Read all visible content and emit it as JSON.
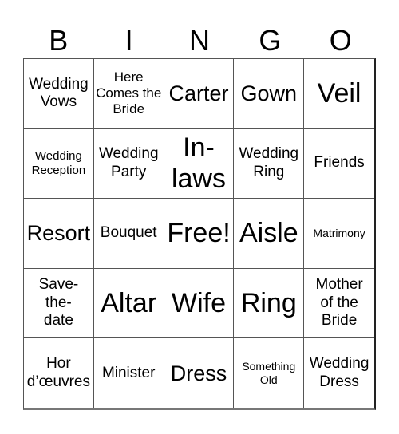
{
  "header": {
    "letters": [
      "B",
      "I",
      "N",
      "G",
      "O"
    ]
  },
  "board": {
    "rows": [
      [
        "Wedding Vows",
        "Here Comes the Bride",
        "Carter",
        "Gown",
        "Veil"
      ],
      [
        "Wedding Reception",
        "Wedding Party",
        "In-laws",
        "Wedding Ring",
        "Friends"
      ],
      [
        "Resort",
        "Bouquet",
        "Free!",
        "Aisle",
        "Matrimony"
      ],
      [
        "Save-the-date",
        "Altar",
        "Wife",
        "Ring",
        "Mother of the Bride"
      ],
      [
        "Hor d’œuvres",
        "Minister",
        "Dress",
        "Something Old",
        "Wedding Dress"
      ]
    ],
    "free_space": "Free!"
  }
}
